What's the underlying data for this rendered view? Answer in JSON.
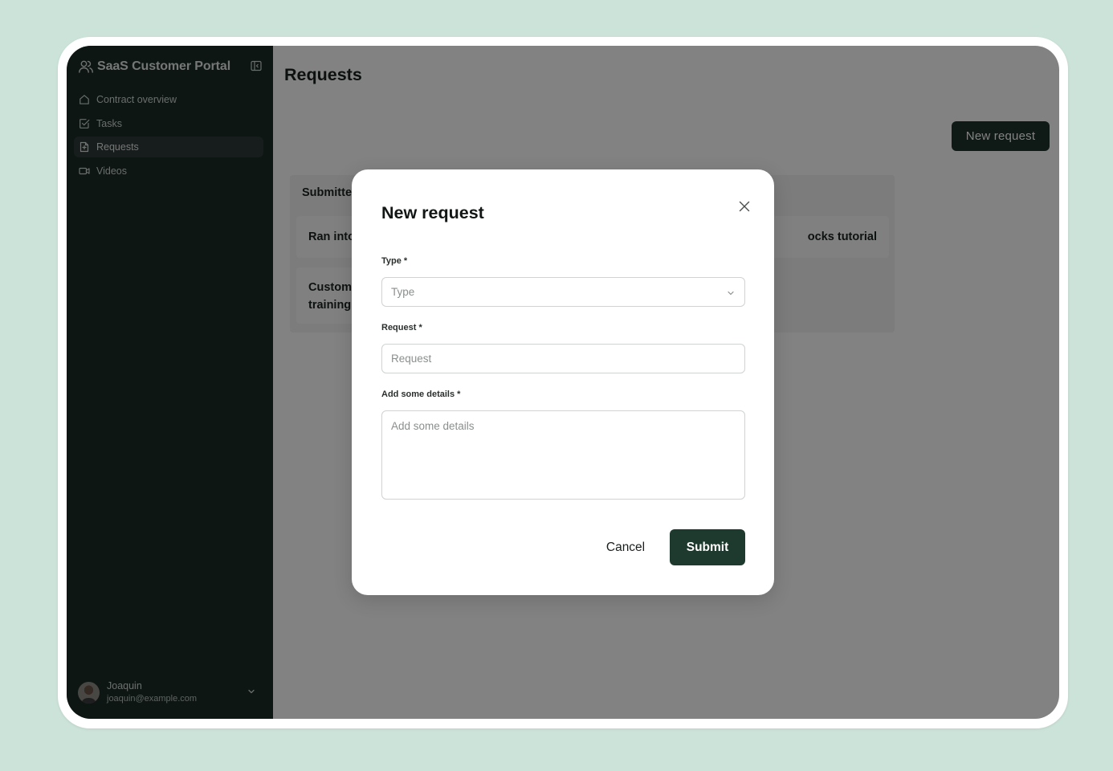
{
  "app": {
    "title": "SaaS Customer Portal"
  },
  "sidebar": {
    "items": [
      {
        "label": "Contract overview",
        "icon": "home-icon",
        "active": false
      },
      {
        "label": "Tasks",
        "icon": "checkbox-icon",
        "active": false
      },
      {
        "label": "Requests",
        "icon": "file-icon",
        "active": true
      },
      {
        "label": "Videos",
        "icon": "video-icon",
        "active": false
      }
    ],
    "user": {
      "name": "Joaquin",
      "email": "joaquin@example.com"
    }
  },
  "main": {
    "title": "Requests",
    "new_request_label": "New request",
    "board": {
      "column_title_visible": "Submitte",
      "cards": [
        {
          "text_visible": "Ran into"
        },
        {
          "text_visible_line1": "Custom",
          "text_visible_line2": "training"
        },
        {
          "text_visible": "ocks tutorial"
        }
      ]
    }
  },
  "modal": {
    "title": "New request",
    "type_label": "Type *",
    "type_placeholder": "Type",
    "request_label": "Request *",
    "request_placeholder": "Request",
    "details_label": "Add some details *",
    "details_placeholder": "Add some details",
    "cancel_label": "Cancel",
    "submit_label": "Submit"
  },
  "colors": {
    "background": "#cce3d9",
    "sidebar": "#1b2b27",
    "primary_button": "#1e3a2e"
  }
}
